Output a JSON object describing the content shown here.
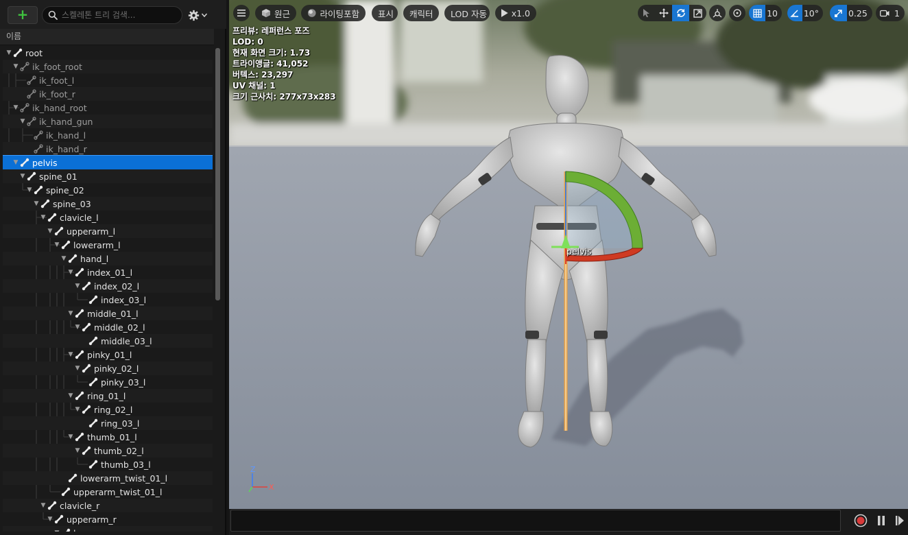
{
  "left_panel": {
    "search_placeholder": "스켈레톤 트리 검색...",
    "column_header": "이름",
    "tree": [
      {
        "label": "root",
        "depth": 0,
        "expanded": true,
        "virtual": false
      },
      {
        "label": "ik_foot_root",
        "depth": 1,
        "expanded": true,
        "virtual": true
      },
      {
        "label": "ik_foot_l",
        "depth": 2,
        "expanded": null,
        "virtual": true
      },
      {
        "label": "ik_foot_r",
        "depth": 2,
        "expanded": null,
        "virtual": true
      },
      {
        "label": "ik_hand_root",
        "depth": 1,
        "expanded": true,
        "virtual": true
      },
      {
        "label": "ik_hand_gun",
        "depth": 2,
        "expanded": true,
        "virtual": true
      },
      {
        "label": "ik_hand_l",
        "depth": 3,
        "expanded": null,
        "virtual": true
      },
      {
        "label": "ik_hand_r",
        "depth": 3,
        "expanded": null,
        "virtual": true
      },
      {
        "label": "pelvis",
        "depth": 1,
        "expanded": true,
        "virtual": false,
        "selected": true
      },
      {
        "label": "spine_01",
        "depth": 2,
        "expanded": true,
        "virtual": false
      },
      {
        "label": "spine_02",
        "depth": 3,
        "expanded": true,
        "virtual": false
      },
      {
        "label": "spine_03",
        "depth": 4,
        "expanded": true,
        "virtual": false
      },
      {
        "label": "clavicle_l",
        "depth": 5,
        "expanded": true,
        "virtual": false
      },
      {
        "label": "upperarm_l",
        "depth": 6,
        "expanded": true,
        "virtual": false
      },
      {
        "label": "lowerarm_l",
        "depth": 7,
        "expanded": true,
        "virtual": false
      },
      {
        "label": "hand_l",
        "depth": 8,
        "expanded": true,
        "virtual": false
      },
      {
        "label": "index_01_l",
        "depth": 9,
        "expanded": true,
        "virtual": false
      },
      {
        "label": "index_02_l",
        "depth": 10,
        "expanded": true,
        "virtual": false
      },
      {
        "label": "index_03_l",
        "depth": 11,
        "expanded": null,
        "virtual": false
      },
      {
        "label": "middle_01_l",
        "depth": 9,
        "expanded": true,
        "virtual": false
      },
      {
        "label": "middle_02_l",
        "depth": 10,
        "expanded": true,
        "virtual": false
      },
      {
        "label": "middle_03_l",
        "depth": 11,
        "expanded": null,
        "virtual": false
      },
      {
        "label": "pinky_01_l",
        "depth": 9,
        "expanded": true,
        "virtual": false
      },
      {
        "label": "pinky_02_l",
        "depth": 10,
        "expanded": true,
        "virtual": false
      },
      {
        "label": "pinky_03_l",
        "depth": 11,
        "expanded": null,
        "virtual": false
      },
      {
        "label": "ring_01_l",
        "depth": 9,
        "expanded": true,
        "virtual": false
      },
      {
        "label": "ring_02_l",
        "depth": 10,
        "expanded": true,
        "virtual": false
      },
      {
        "label": "ring_03_l",
        "depth": 11,
        "expanded": null,
        "virtual": false
      },
      {
        "label": "thumb_01_l",
        "depth": 9,
        "expanded": true,
        "virtual": false
      },
      {
        "label": "thumb_02_l",
        "depth": 10,
        "expanded": true,
        "virtual": false
      },
      {
        "label": "thumb_03_l",
        "depth": 11,
        "expanded": null,
        "virtual": false
      },
      {
        "label": "lowerarm_twist_01_l",
        "depth": 8,
        "expanded": null,
        "virtual": false
      },
      {
        "label": "upperarm_twist_01_l",
        "depth": 7,
        "expanded": null,
        "virtual": false
      },
      {
        "label": "clavicle_r",
        "depth": 5,
        "expanded": true,
        "virtual": false
      },
      {
        "label": "upperarm_r",
        "depth": 6,
        "expanded": true,
        "virtual": false
      },
      {
        "label": "lowerarm_r",
        "depth": 7,
        "expanded": true,
        "virtual": false
      }
    ]
  },
  "viewport": {
    "toolbar": {
      "perspective": "원근",
      "lighting": "라이팅포함",
      "show": "표시",
      "character": "캐릭터",
      "lod": "LOD 자동",
      "speed": "x1.0",
      "grid_snap": "10",
      "rotation_snap": "10°",
      "scale_snap": "0.25",
      "camera_speed": "1"
    },
    "stats": [
      "프리뷰: 레퍼런스 포즈",
      "LOD: 0",
      "현재 화면 크기: 1.73",
      "트라이앵글: 41,052",
      "버텍스: 23,297",
      "UV 채널: 1",
      "크기 근사치: 277x73x283"
    ],
    "gizmo_label": "pelvis",
    "axis": {
      "z": "Z",
      "x": "X"
    }
  },
  "bottom": {
    "command_value": ""
  },
  "colors": {
    "selection": "#0b70d6",
    "accent_blue": "#1976d2",
    "add_green": "#3fc23f",
    "record_red": "#d83a3a"
  }
}
